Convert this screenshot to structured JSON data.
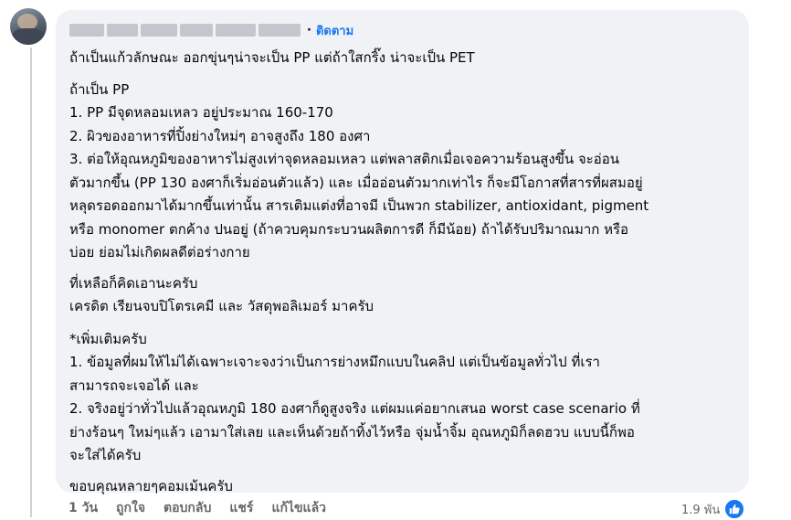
{
  "comment": {
    "author_name": "",
    "follow_label": "ติดตาม",
    "separator": "·",
    "paragraphs": {
      "p1": "ถ้าเป็นแก้วลักษณะ ออกขุ่นๆน่าจะเป็น PP แต่ถ้าใสกริ๊ง น่าจะเป็น PET",
      "p2": "ถ้าเป็น PP",
      "p3": "1. PP มีจุดหลอมเหลว อยู่ประมาณ 160-170",
      "p4": "2. ผิวของอาหารที่ปิ้งย่างใหม่ๆ อาจสูงถึง 180 องศา",
      "p5": "3. ต่อให้อุณหภูมิของอาหารไม่สูงเท่าจุดหลอมเหลว แต่พลาสติกเมื่อเจอความร้อนสูงขึ้น จะอ่อน",
      "p6": "ตัวมากขึ้น (PP 130 องศาก็เริ่มอ่อนตัวแล้ว) และ เมื่ออ่อนตัวมากเท่าไร ก็จะมีโอกาสที่สารที่ผสมอยู่",
      "p7": "หลุดรอดออกมาได้มากขึ้นเท่านั้น สารเติมแต่งที่อาจมี เป็นพวก stabilizer, antioxidant, pigment",
      "p8": "หรือ monomer ตกค้าง ปนอยู่ (ถ้าควบคุมกระบวนผลิตการดี ก็มีน้อย) ถ้าได้รับปริมาณมาก หรือ",
      "p9": "บ่อย ย่อมไม่เกิดผลดีต่อร่างกาย",
      "p10": "ที่เหลือก็คิดเอานะครับ",
      "p11": "เครดิต เรียนจบปิโตรเคมี และ วัสดุพอลิเมอร์ มาครับ",
      "p12": "*เพิ่มเติมครับ",
      "p13": "1. ข้อมูลที่ผมให้ไม่ได้เฉพาะเจาะจงว่าเป็นการย่างหมึกแบบในคลิป แต่เป็นข้อมูลทั่วไป ที่เรา",
      "p14": "สามารถจะเจอได้ และ",
      "p15": "2. จริงอยู่ว่าทั่วไปแล้วอุณหภูมิ 180 องศาก็ดูสูงจริง แต่ผมแค่อยากเสนอ worst case scenario ที่",
      "p16": "ย่างร้อนๆ ใหม่ๆแล้ว เอามาใส่เลย และเห็นด้วยถ้าทิ้งไว้หรือ จุ่มน้ำจิ้ม อุณหภูมิก็ลดฮวบ แบบนี้ก็พอ",
      "p17": "จะใส่ได้ครับ",
      "p18": "ขอบคุณหลายๆคอมเม้นครับ"
    }
  },
  "actions": {
    "time": "1 วัน",
    "like": "ถูกใจ",
    "reply": "ตอบกลับ",
    "share": "แชร์",
    "edited": "แก้ไขแล้ว"
  },
  "reactions": {
    "count": "1.9 พัน",
    "icon": "thumbs-up-icon"
  },
  "colors": {
    "accent": "#1877f2",
    "bubble": "#f0f2f5",
    "muted": "#65676b"
  }
}
